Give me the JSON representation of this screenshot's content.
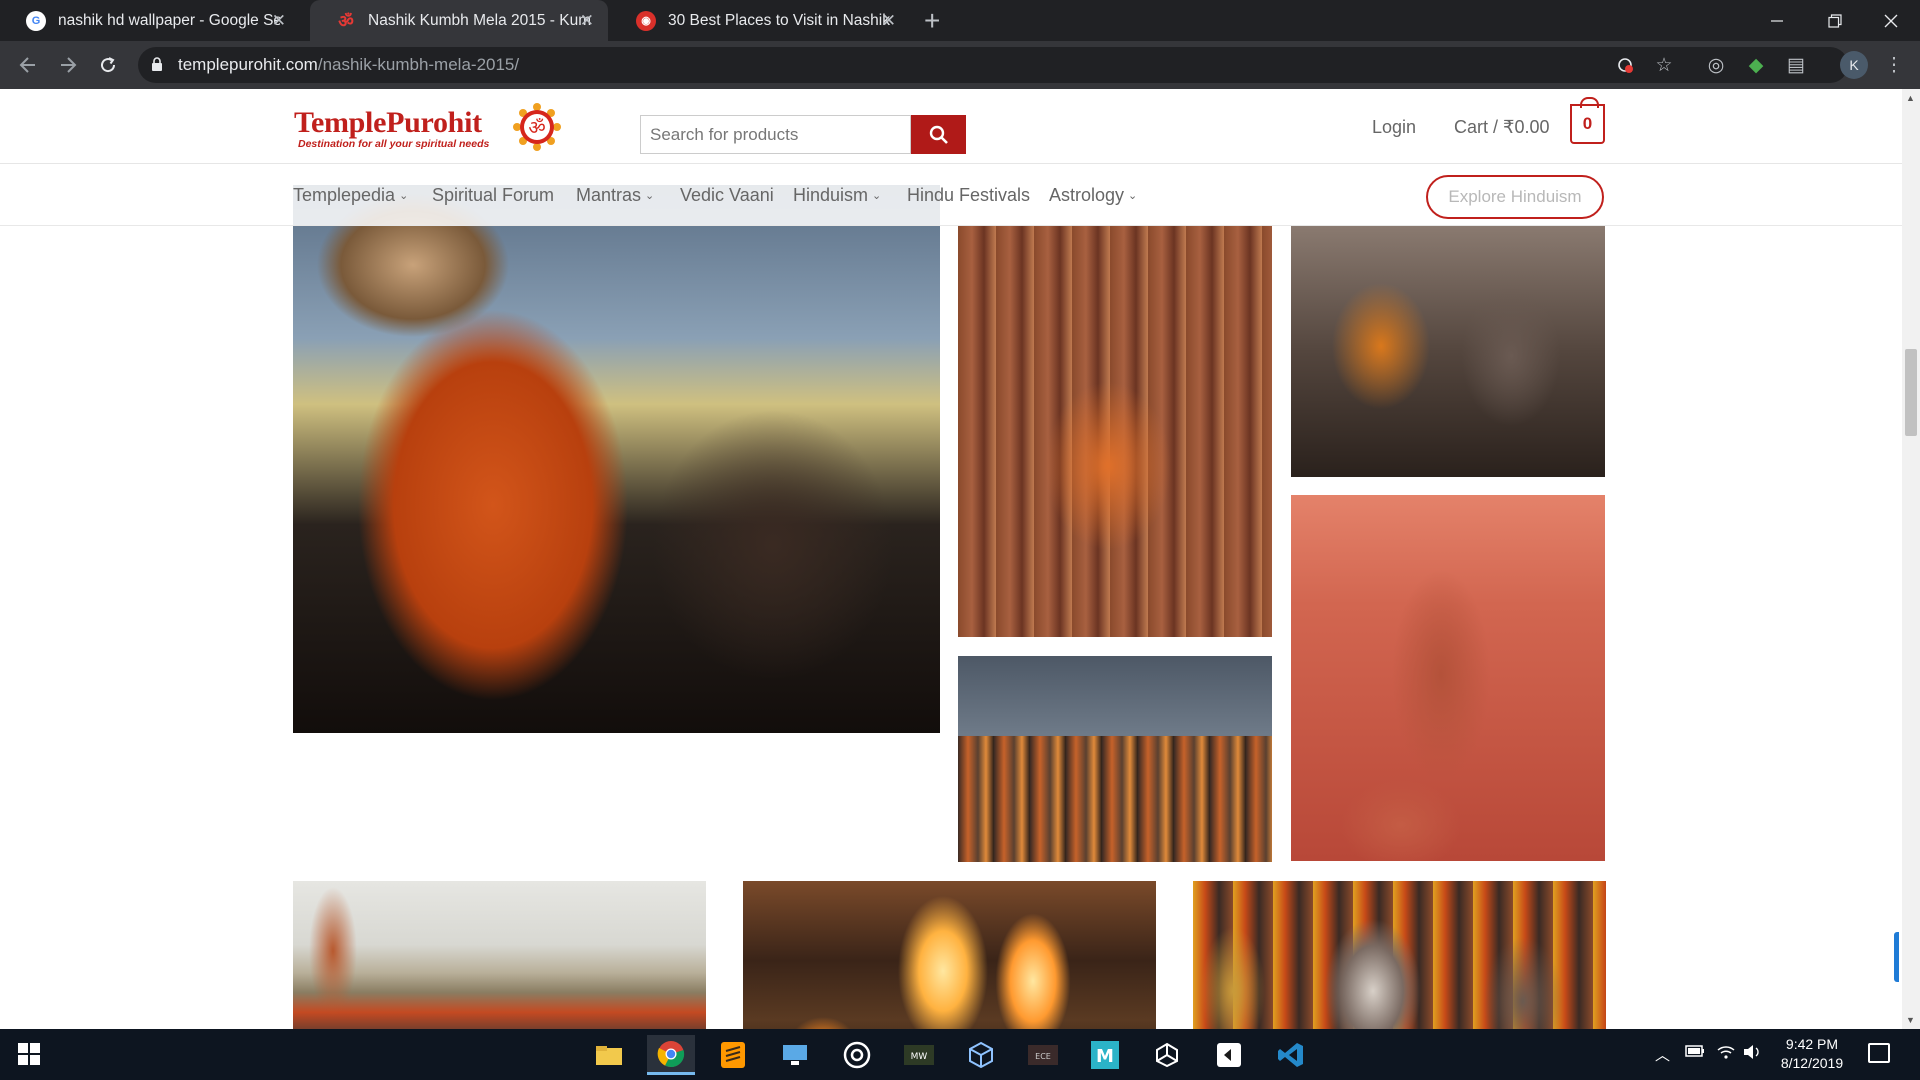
{
  "browser": {
    "tabs": [
      {
        "title": "nashik hd wallpaper - Google Sea",
        "favicon": "google-g-icon",
        "active": false
      },
      {
        "title": "Nashik Kumbh Mela 2015 - Kumb",
        "favicon": "om-icon",
        "active": true
      },
      {
        "title": "30 Best Places to Visit in Nashik -",
        "favicon": "target-icon",
        "active": false
      }
    ],
    "url_host": "templepurohit.com",
    "url_path": "/nashik-kumbh-mela-2015/",
    "profile_initial": "K"
  },
  "site": {
    "logo_text": "TemplePurohit",
    "tagline": "Destination for all your spiritual needs",
    "search_placeholder": "Search for products",
    "login_label": "Login",
    "cart_label": "Cart / ₹0.00",
    "cart_count": "0",
    "nav": [
      {
        "label": "Templepedia",
        "has_dropdown": true
      },
      {
        "label": "Spiritual Forum",
        "has_dropdown": false
      },
      {
        "label": "Mantras",
        "has_dropdown": true
      },
      {
        "label": "Vedic Vaani",
        "has_dropdown": false
      },
      {
        "label": "Hinduism",
        "has_dropdown": true
      },
      {
        "label": "Hindu Festivals",
        "has_dropdown": false
      },
      {
        "label": "Astrology",
        "has_dropdown": true
      }
    ],
    "explore_label": "Explore Hinduism",
    "brand_color": "#c0201c"
  },
  "taskbar": {
    "time": "9:42 PM",
    "date": "8/12/2019"
  }
}
